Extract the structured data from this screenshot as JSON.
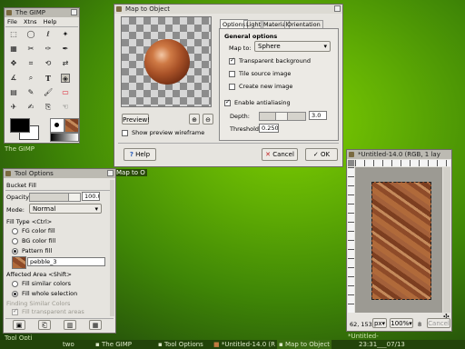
{
  "toolbox": {
    "title": "The GIMP",
    "menu": [
      "File",
      "Xtns",
      "Help"
    ],
    "label": "The GIMP"
  },
  "map_to_object": {
    "title": "Map to Object",
    "tabs": [
      "Options",
      "Light",
      "Material",
      "Orientation"
    ],
    "section": "General options",
    "map_to_label": "Map to:",
    "map_to_value": "Sphere",
    "checks": [
      {
        "label": "Transparent background",
        "checked": true
      },
      {
        "label": "Tile source image",
        "checked": false
      },
      {
        "label": "Create new image",
        "checked": false
      },
      {
        "label": "Enable antialiasing",
        "checked": true
      }
    ],
    "depth_label": "Depth:",
    "depth_value": "3.0",
    "threshold_label": "Threshold:",
    "threshold_value": "0.250",
    "preview_button": "Preview!",
    "show_wireframe": "Show preview wireframe",
    "help": "Help",
    "cancel": "Cancel",
    "ok": "OK"
  },
  "map_to_label_tag": "Map to O",
  "tool_options": {
    "title": "Tool Options",
    "heading": "Bucket Fill",
    "opacity_label": "Opacity:",
    "opacity_value": "100.0",
    "mode_label": "Mode:",
    "mode_value": "Normal",
    "fill_type": "Fill Type  <Ctrl>",
    "fill_options": [
      {
        "label": "FG color fill",
        "checked": false
      },
      {
        "label": "BG color fill",
        "checked": false
      },
      {
        "label": "Pattern fill",
        "checked": true
      }
    ],
    "pattern_name": "pebble_3",
    "affected_area": "Affected Area  <Shift>",
    "area_options": [
      {
        "label": "Fill similar colors",
        "checked": false
      },
      {
        "label": "Fill whole selection",
        "checked": true
      }
    ],
    "finding_similar": "Finding Similar Colors",
    "fill_transparent": "Fill transparent areas",
    "label": "Tool Opti"
  },
  "image_window": {
    "title": "*Untitled-14.0 (RGB, 1 lay",
    "coords": "62, 153",
    "unit": "px",
    "zoom": "100%",
    "cancel": "Cancel",
    "status_digit": "8",
    "label": "*Untitled-"
  },
  "taskbar": {
    "workspace": "two",
    "tasks": [
      "The GIMP",
      "Tool Options",
      "*Untitled-14.0 (R",
      "Map to Object"
    ],
    "clock": "23:31___07/13"
  }
}
